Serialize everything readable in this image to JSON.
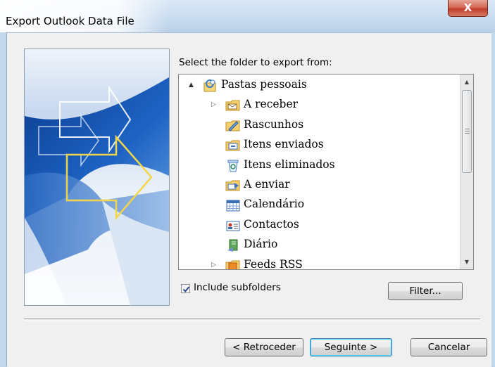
{
  "window": {
    "title": "Export Outlook Data File",
    "close_glyph": "X"
  },
  "prompt_label": "Select the folder to export from:",
  "tree": {
    "items": [
      {
        "label": "Pastas pessoais",
        "icon": "personal-folders-icon",
        "level": 0,
        "expander": "▲"
      },
      {
        "label": "A receber",
        "icon": "inbox-folder-icon",
        "level": 1,
        "expander": "▷"
      },
      {
        "label": "Rascunhos",
        "icon": "drafts-folder-icon",
        "level": 1,
        "expander": ""
      },
      {
        "label": "Itens enviados",
        "icon": "sent-items-folder-icon",
        "level": 1,
        "expander": ""
      },
      {
        "label": "Itens eliminados",
        "icon": "deleted-items-folder-icon",
        "level": 1,
        "expander": ""
      },
      {
        "label": "A enviar",
        "icon": "outbox-folder-icon",
        "level": 1,
        "expander": ""
      },
      {
        "label": "Calendário",
        "icon": "calendar-folder-icon",
        "level": 1,
        "expander": ""
      },
      {
        "label": "Contactos",
        "icon": "contacts-folder-icon",
        "level": 1,
        "expander": ""
      },
      {
        "label": "Diário",
        "icon": "journal-folder-icon",
        "level": 1,
        "expander": ""
      },
      {
        "label": "Feeds RSS",
        "icon": "rss-feeds-folder-icon",
        "level": 1,
        "expander": "▷"
      }
    ]
  },
  "include_subfolders": {
    "label": "Include subfolders",
    "checked": true
  },
  "buttons": {
    "filter": "Filter...",
    "back": "< Retroceder",
    "next": "Seguinte >",
    "cancel": "Cancelar"
  }
}
